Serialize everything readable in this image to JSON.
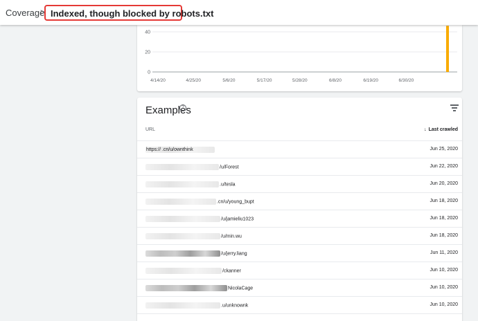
{
  "header": {
    "breadcrumb": "Coverage",
    "chevron": ">",
    "current": "Indexed, though blocked by robots.txt"
  },
  "chart_data": {
    "type": "bar",
    "y_ticks": [
      "40",
      "20",
      "0"
    ],
    "x_ticks": [
      "4/14/20",
      "4/25/20",
      "5/6/20",
      "5/17/20",
      "5/28/20",
      "6/8/20",
      "6/19/20",
      "6/30/20"
    ],
    "series": [
      {
        "values": [
          {
            "x": "7/5/20",
            "y": 46
          }
        ]
      }
    ],
    "bar_color": "#f9ab00"
  },
  "examples": {
    "title": "Examples",
    "help_icon": "help-circle-icon",
    "filter_icon": "filter-icon",
    "col_url": "URL",
    "col_crawled": "Last crawled",
    "sort_icon": "arrow-down-icon",
    "rows": [
      {
        "url": "https://                    .cn/u/ownthink",
        "date": "Jun 25, 2020"
      },
      {
        "url": "/u/Forest",
        "date": "Jun 22, 2020"
      },
      {
        "url": ".u/tesla",
        "date": "Jun 20, 2020"
      },
      {
        "url": ".cn/u/young_bupt",
        "date": "Jun 18, 2020"
      },
      {
        "url": "/u/jamieliu1023",
        "date": "Jun 18, 2020"
      },
      {
        "url": "/u/min.wu",
        "date": "Jun 18, 2020"
      },
      {
        "url": "/u/jerry.liang",
        "date": "Jun 11, 2020"
      },
      {
        "url": "/ckanner",
        "date": "Jun 10, 2020"
      },
      {
        "url": "NicolaCage",
        "date": "Jun 10, 2020"
      },
      {
        "url": ".u/unknownk",
        "date": "Jun 10, 2020"
      }
    ]
  }
}
